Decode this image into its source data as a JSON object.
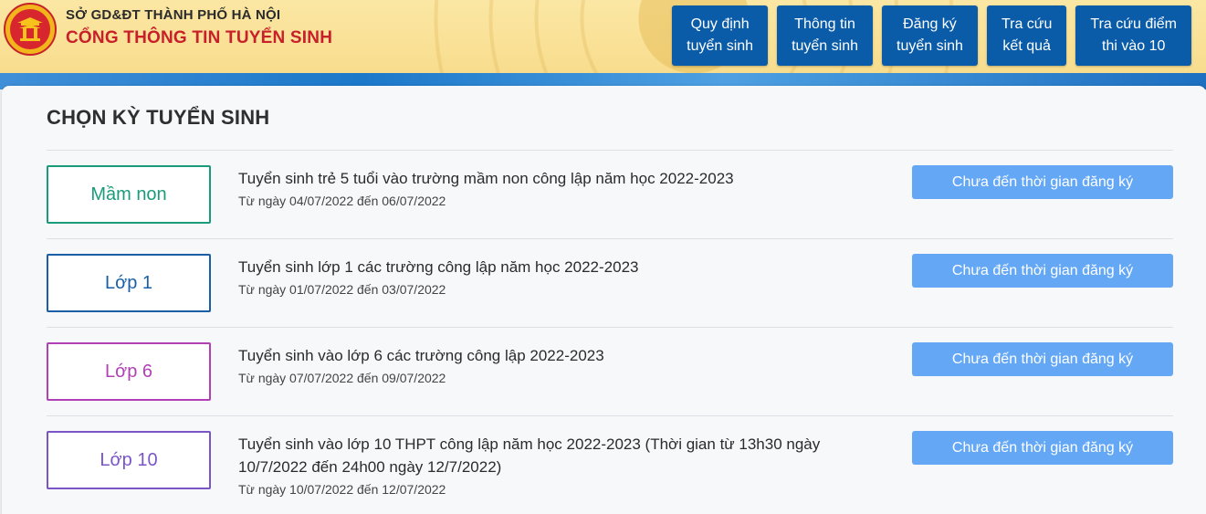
{
  "header": {
    "org": "SỞ GD&ĐT THÀNH PHỐ HÀ NỘI",
    "portal": "CỔNG THÔNG TIN TUYỂN SINH",
    "nav": [
      {
        "line1": "Quy định",
        "line2": "tuyển sinh"
      },
      {
        "line1": "Thông tin",
        "line2": "tuyển sinh"
      },
      {
        "line1": "Đăng ký",
        "line2": "tuyển sinh"
      },
      {
        "line1": "Tra cứu",
        "line2": "kết quả"
      },
      {
        "line1": "Tra cứu điểm",
        "line2": "thi vào 10"
      }
    ]
  },
  "main": {
    "title": "CHỌN KỲ TUYỂN SINH",
    "items": [
      {
        "badge": "Mầm non",
        "title": "Tuyển sinh trẻ 5 tuổi vào trường mầm non công lập năm học 2022-2023",
        "date": "Từ ngày 04/07/2022 đến 06/07/2022",
        "status": "Chưa đến thời gian đăng ký",
        "color": "#1a9c7c"
      },
      {
        "badge": "Lớp 1",
        "title": "Tuyển sinh lớp 1 các trường công lập năm học 2022-2023",
        "date": "Từ ngày 01/07/2022 đến 03/07/2022",
        "status": "Chưa đến thời gian đăng ký",
        "color": "#1a5fa6"
      },
      {
        "badge": "Lớp 6",
        "title": "Tuyển sinh vào lớp 6 các trường công lập 2022-2023",
        "date": "Từ ngày 07/07/2022 đến 09/07/2022",
        "status": "Chưa đến thời gian đăng ký",
        "color": "#b13fb6"
      },
      {
        "badge": "Lớp 10",
        "title": "Tuyển sinh vào lớp 10 THPT công lập năm học 2022-2023 (Thời gian từ 13h30 ngày 10/7/2022 đến 24h00 ngày 12/7/2022)",
        "date": "Từ ngày 10/07/2022 đến 12/07/2022",
        "status": "Chưa đến thời gian đăng ký",
        "color": "#7a55c8"
      }
    ]
  },
  "colors": {
    "nav_bg": "#0a5ca8",
    "status_btn": "#64a8f5",
    "portal_title": "#c8202a"
  }
}
